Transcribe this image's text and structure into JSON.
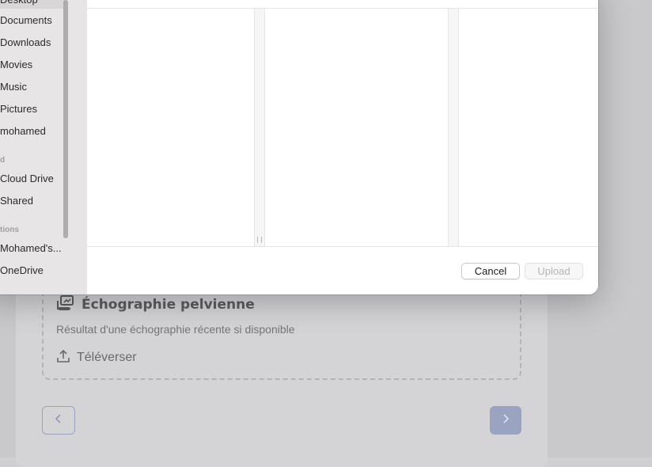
{
  "sidebar": {
    "items": [
      {
        "label": "Desktop"
      },
      {
        "label": "Documents"
      },
      {
        "label": "Downloads"
      },
      {
        "label": "Movies"
      },
      {
        "label": "Music"
      },
      {
        "label": "Pictures"
      },
      {
        "label": "mohamed"
      }
    ],
    "cloud_header": "d",
    "cloud_items": [
      {
        "label": "Cloud Drive"
      },
      {
        "label": "Shared"
      }
    ],
    "locations_header": "tions",
    "location_items": [
      {
        "label": "Mohamed's..."
      },
      {
        "label": "OneDrive"
      }
    ]
  },
  "dialog": {
    "cancel_label": "Cancel",
    "upload_label": "Upload"
  },
  "page": {
    "upload_title": "Échographie pelvienne",
    "upload_desc": "Résultat d'une échographie récente si disponible",
    "upload_action": "Téléverser",
    "prev_icon": "chevron-left-icon",
    "next_icon": "chevron-right-icon"
  },
  "colors": {
    "accent_next_button": "#9aa3c0",
    "sidebar_bg": "#e8e5e6"
  }
}
